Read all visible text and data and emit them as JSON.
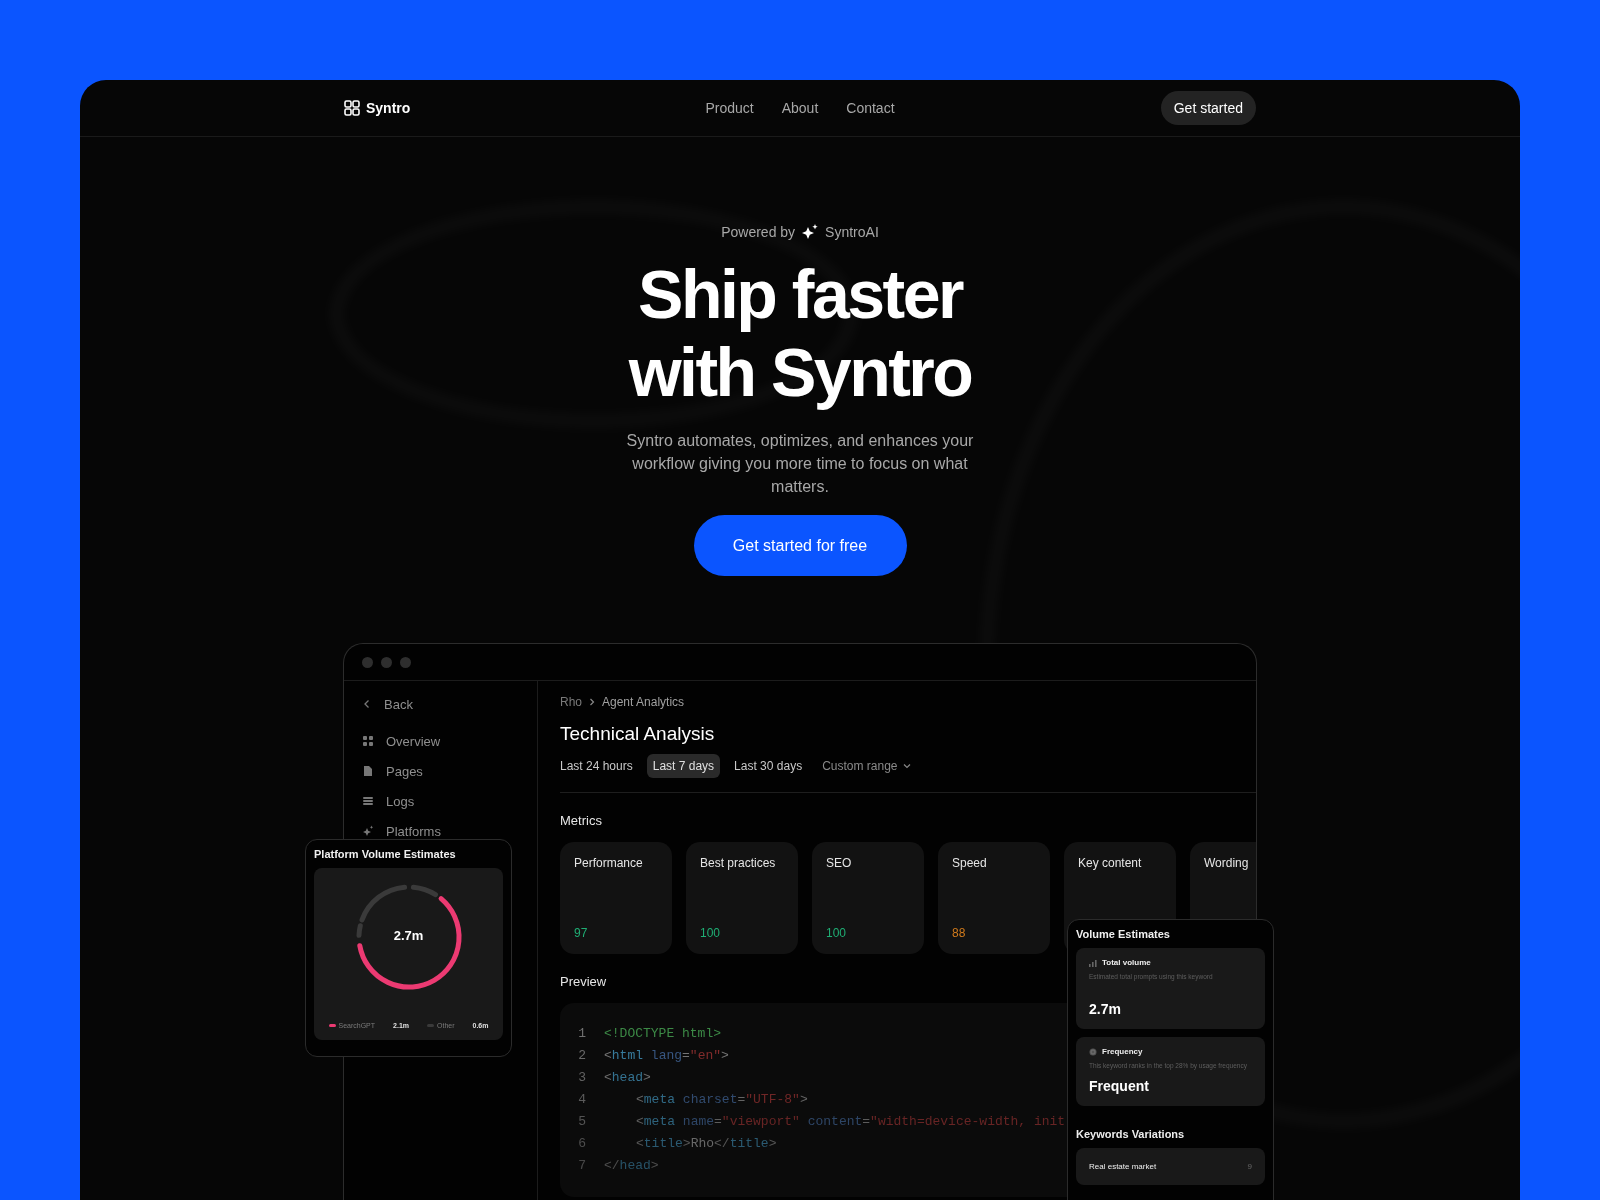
{
  "nav": {
    "logo": "Syntro",
    "links": [
      "Product",
      "About",
      "Contact"
    ],
    "cta": "Get started"
  },
  "hero": {
    "powered_prefix": "Powered by",
    "powered_brand": "SyntroAI",
    "heading_lines": [
      "Ship faster",
      "with Syntro"
    ],
    "subtitle": "Syntro automates, optimizes, and enhances your workflow giving you more time to focus on what matters.",
    "cta": "Get started for free"
  },
  "app": {
    "sidebar": {
      "back": "Back",
      "items": [
        {
          "label": "Overview"
        },
        {
          "label": "Pages"
        },
        {
          "label": "Logs"
        },
        {
          "label": "Platforms"
        }
      ]
    },
    "breadcrumb": [
      "Rho",
      "Agent Analytics"
    ],
    "title": "Technical Analysis",
    "ranges": [
      {
        "label": "Last 24 hours",
        "kind": "tab",
        "selected": false
      },
      {
        "label": "Last 7 days",
        "kind": "tab",
        "selected": true
      },
      {
        "label": "Last 30 days",
        "kind": "tab",
        "selected": false
      },
      {
        "label": "Custom range",
        "kind": "dropdown",
        "selected": false
      }
    ],
    "metrics_heading": "Metrics",
    "metrics": [
      {
        "label": "Performance",
        "value": "97",
        "color": "#1fae74"
      },
      {
        "label": "Best practices",
        "value": "100",
        "color": "#1fae74"
      },
      {
        "label": "SEO",
        "value": "100",
        "color": "#1fae74"
      },
      {
        "label": "Speed",
        "value": "88",
        "color": "#d07a1c"
      },
      {
        "label": "Key content"
      },
      {
        "label": "Wording"
      }
    ],
    "preview_heading": "Preview",
    "code": [
      {
        "number": "1",
        "tokens": [
          {
            "kind": "doctype",
            "text": "<!DOCTYPE html>"
          }
        ]
      },
      {
        "number": "2",
        "tokens": [
          {
            "kind": "punct",
            "text": "<"
          },
          {
            "kind": "tag",
            "text": "html"
          },
          {
            "kind": "attr",
            "text": " lang"
          },
          {
            "kind": "punct",
            "text": "="
          },
          {
            "kind": "string",
            "text": "\"en\""
          },
          {
            "kind": "punct",
            "text": ">"
          }
        ]
      },
      {
        "number": "3",
        "tokens": [
          {
            "kind": "punct",
            "text": "<"
          },
          {
            "kind": "tag",
            "text": "head"
          },
          {
            "kind": "punct",
            "text": ">"
          }
        ],
        "children": [
          {
            "number": "4",
            "tokens": [
              {
                "kind": "punct",
                "text": "<"
              },
              {
                "kind": "tag",
                "text": "meta"
              },
              {
                "kind": "attr",
                "text": " charset"
              },
              {
                "kind": "punct",
                "text": "="
              },
              {
                "kind": "string",
                "text": "\"UTF-8\""
              },
              {
                "kind": "punct",
                "text": ">"
              }
            ]
          },
          {
            "number": "5",
            "tokens": [
              {
                "kind": "punct",
                "text": "<"
              },
              {
                "kind": "tag",
                "text": "meta"
              },
              {
                "kind": "attr",
                "text": " name"
              },
              {
                "kind": "punct",
                "text": "="
              },
              {
                "kind": "string",
                "text": "\"viewport\""
              },
              {
                "kind": "attr",
                "text": " content"
              },
              {
                "kind": "punct",
                "text": "="
              },
              {
                "kind": "string",
                "text": "\"width=device-width, init"
              }
            ]
          },
          {
            "number": "6",
            "tokens": [
              {
                "kind": "punct",
                "text": "<"
              },
              {
                "kind": "tag",
                "text": "title"
              },
              {
                "kind": "punct",
                "text": ">"
              },
              {
                "kind": "plain",
                "text": "Rho"
              },
              {
                "kind": "punct",
                "text": "</"
              },
              {
                "kind": "tag",
                "text": "title"
              },
              {
                "kind": "punct",
                "text": ">"
              }
            ]
          }
        ]
      },
      {
        "number": "7",
        "tokens": [
          {
            "kind": "punct",
            "text": "</"
          },
          {
            "kind": "tag",
            "text": "head"
          },
          {
            "kind": "punct",
            "text": ">"
          }
        ]
      }
    ]
  },
  "platform_card": {
    "title": "Platform Volume Estimates",
    "total": "2.7m",
    "legend": [
      {
        "label": "SearchGPT",
        "value": "2.1m",
        "color": "#ec3a72"
      },
      {
        "label": "Other",
        "value": "0.6m",
        "color": "#3a3a3a"
      }
    ]
  },
  "volume_card": {
    "title": "Volume Estimates",
    "stats": [
      {
        "kind": "bars",
        "title": "Total volume",
        "description": "Estimated total prompts using this keyword",
        "value": "2.7m"
      },
      {
        "kind": "target",
        "title": "Frequency",
        "description": "This keyword ranks in the top 28% by usage frequency",
        "value": "Frequent"
      }
    ],
    "keywords_heading": "Keywords Variations",
    "keywords": [
      {
        "label": "Real estate market",
        "count": "9"
      }
    ]
  }
}
